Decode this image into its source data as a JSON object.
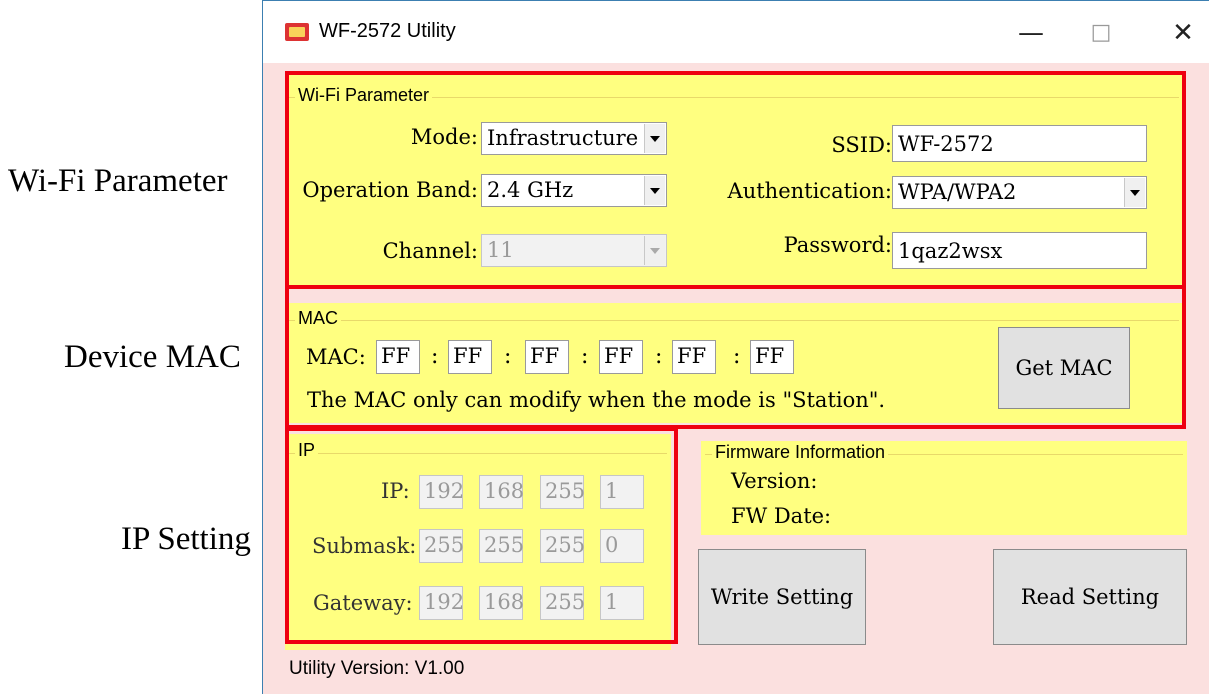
{
  "callouts": {
    "wifi": "Wi-Fi Parameter",
    "mac": "Device MAC",
    "ip": "IP Setting"
  },
  "window": {
    "title": "WF-2572 Utility",
    "minimize": "—",
    "maximize": "□",
    "close": "✕"
  },
  "wifi": {
    "legend": "Wi-Fi Parameter",
    "mode_label": "Mode:",
    "mode_value": "Infrastructure",
    "band_label": "Operation Band:",
    "band_value": "2.4 GHz",
    "channel_label": "Channel:",
    "channel_value": "11",
    "ssid_label": "SSID:",
    "ssid_value": "WF-2572",
    "auth_label": "Authentication:",
    "auth_value": "WPA/WPA2",
    "password_label": "Password:",
    "password_value": "1qaz2wsx"
  },
  "mac": {
    "legend": "MAC",
    "label": "MAC:",
    "octets": [
      "FF",
      "FF",
      "FF",
      "FF",
      "FF",
      "FF"
    ],
    "separator": ":",
    "note": "The MAC only can modify when the mode is \"Station\".",
    "get_button": "Get MAC"
  },
  "ip": {
    "legend": "IP",
    "ip_label": "IP:",
    "ip": [
      "192",
      "168",
      "255",
      "1"
    ],
    "submask_label": "Submask:",
    "submask": [
      "255",
      "255",
      "255",
      "0"
    ],
    "gateway_label": "Gateway:",
    "gateway": [
      "192",
      "168",
      "255",
      "1"
    ]
  },
  "firmware": {
    "legend": "Firmware Information",
    "version_label": "Version:",
    "date_label": "FW Date:"
  },
  "actions": {
    "write": "Write Setting",
    "read": "Read Setting"
  },
  "footer": {
    "utility_version": "Utility Version: V1.00"
  }
}
